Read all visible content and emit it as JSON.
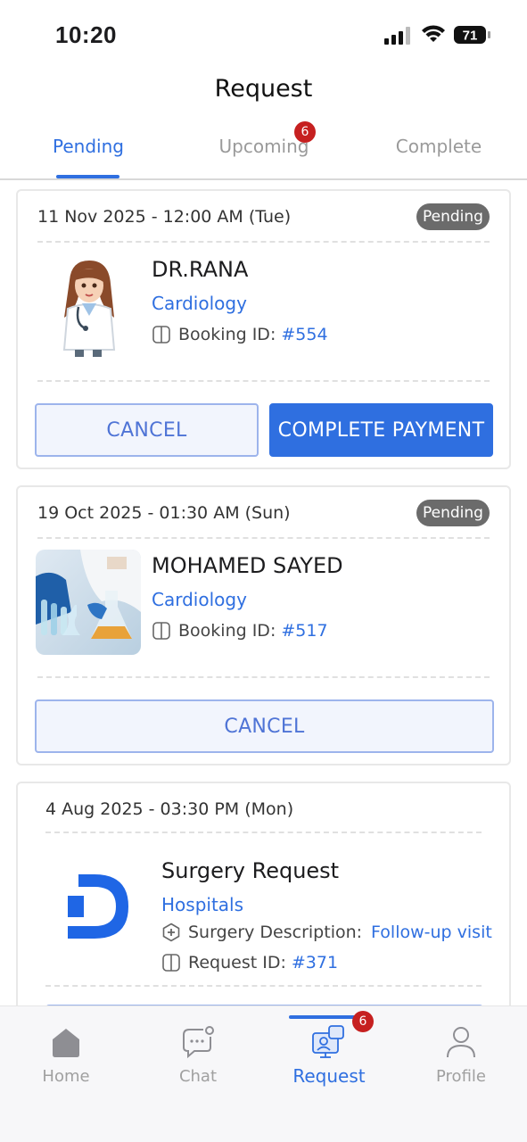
{
  "status_bar": {
    "time": "10:20",
    "battery": "71"
  },
  "header": {
    "title": "Request"
  },
  "tabs": [
    {
      "label": "Pending",
      "active": true
    },
    {
      "label": "Upcoming",
      "badge": "6"
    },
    {
      "label": "Complete"
    }
  ],
  "cards": [
    {
      "date": "11 Nov 2025 - 12:00 AM (Tue)",
      "status": "Pending",
      "name": "DR.RANA",
      "specialty": "Cardiology",
      "id_label": "Booking ID:",
      "id_value": "#554",
      "cancel_label": "CANCEL",
      "pay_label": "COMPLETE PAYMENT"
    },
    {
      "date": "19 Oct 2025 - 01:30 AM (Sun)",
      "status": "Pending",
      "name": "MOHAMED SAYED",
      "specialty": "Cardiology",
      "id_label": "Booking ID:",
      "id_value": "#517",
      "cancel_label": "CANCEL"
    },
    {
      "date": "4 Aug 2025 - 03:30 PM (Mon)",
      "name": "Surgery Request",
      "specialty": "Hospitals",
      "desc_label": "Surgery Description:",
      "desc_value": "Follow-up visit",
      "id_label": "Request ID:",
      "id_value": "#371"
    }
  ],
  "bottom_nav": [
    {
      "label": "Home",
      "icon": "home-icon"
    },
    {
      "label": "Chat",
      "icon": "chat-icon"
    },
    {
      "label": "Request",
      "icon": "request-icon",
      "active": true,
      "badge": "6"
    },
    {
      "label": "Profile",
      "icon": "profile-icon"
    }
  ],
  "colors": {
    "accent": "#2f6fe0",
    "badge": "#c62020",
    "status_pill": "#6b6b6b"
  }
}
